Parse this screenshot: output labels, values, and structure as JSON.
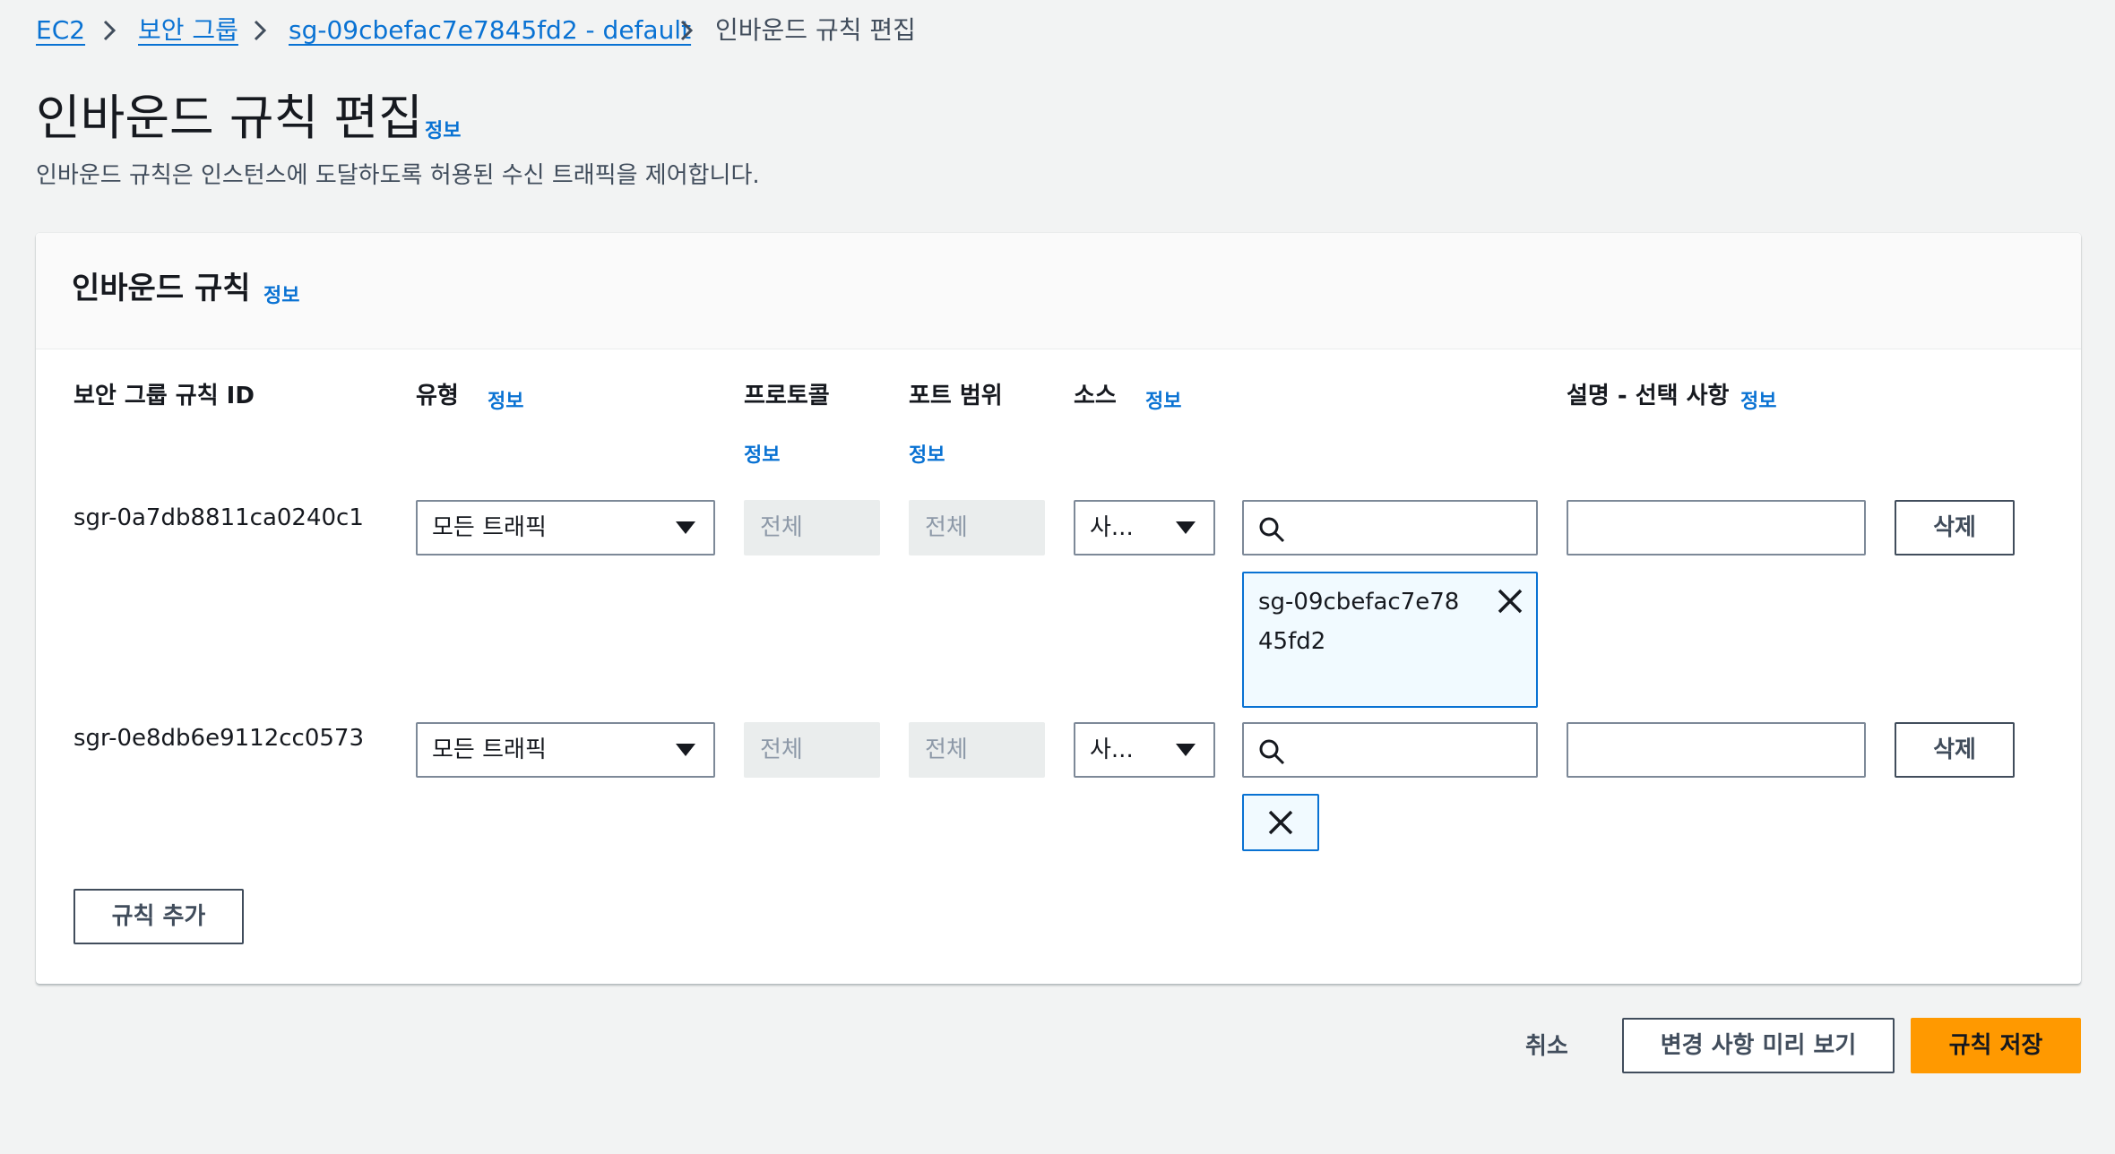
{
  "breadcrumb": {
    "items": [
      "EC2",
      "보안 그룹",
      "sg-09cbefac7e7845fd2 - default"
    ],
    "current": "인바운드 규칙 편집"
  },
  "page": {
    "title": "인바운드 규칙 편집",
    "info": "정보",
    "description": "인바운드 규칙은 인스턴스에 도달하도록 허용된 수신 트래픽을 제어합니다."
  },
  "panel": {
    "title": "인바운드 규칙",
    "info": "정보",
    "columns": {
      "rule_id": "보안 그룹 규칙 ID",
      "type": "유형",
      "protocol": "프로토콜",
      "port_range": "포트 범위",
      "source": "소스",
      "description": "설명 - 선택 사항"
    },
    "info_label": "정보",
    "rules": [
      {
        "id": "sgr-0a7db8811ca0240c1",
        "type": "모든 트래픽",
        "protocol": "전체",
        "port_range": "전체",
        "source_type": "사...",
        "source_token": "sg-09cbefac7e7845fd2",
        "description": "",
        "delete_label": "삭제"
      },
      {
        "id": "sgr-0e8db6e9112cc0573",
        "type": "모든 트래픽",
        "protocol": "전체",
        "port_range": "전체",
        "source_type": "사...",
        "source_token": "",
        "description": "",
        "delete_label": "삭제"
      }
    ],
    "add_rule_label": "규칙 추가"
  },
  "footer": {
    "cancel_label": "취소",
    "preview_label": "변경 사항 미리 보기",
    "save_label": "규칙 저장"
  },
  "colors": {
    "link": "#0972d3",
    "primary": "#ff9900",
    "background": "#f2f3f3"
  }
}
